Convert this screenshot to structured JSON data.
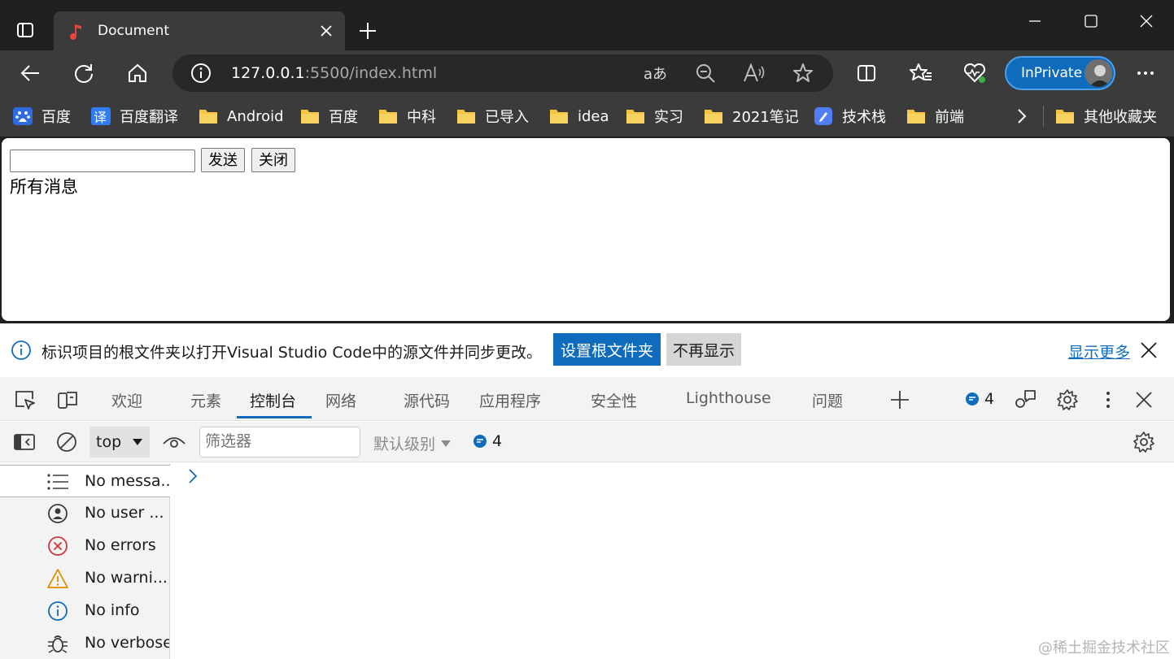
{
  "window": {
    "tab_title": "Document"
  },
  "toolbar": {
    "url_host": "127.0.0.1",
    "url_rest": ":5500/index.html",
    "inprivate_label": "InPrivate"
  },
  "bookmarks": [
    {
      "label": "百度",
      "icon": "baidu-icon"
    },
    {
      "label": "百度翻译",
      "icon": "translate-icon"
    },
    {
      "label": "Android",
      "icon": "folder-icon"
    },
    {
      "label": "百度",
      "icon": "folder-icon"
    },
    {
      "label": "中科",
      "icon": "folder-icon"
    },
    {
      "label": "已导入",
      "icon": "folder-icon"
    },
    {
      "label": "idea",
      "icon": "folder-icon"
    },
    {
      "label": "实习",
      "icon": "folder-icon"
    },
    {
      "label": "2021笔记",
      "icon": "folder-icon"
    },
    {
      "label": "技术栈",
      "icon": "app-icon"
    },
    {
      "label": "前端",
      "icon": "folder-icon"
    }
  ],
  "other_bookmarks_label": "其他收藏夹",
  "page": {
    "send_label": "发送",
    "close_label": "关闭",
    "messages_label": "所有消息"
  },
  "devtools": {
    "infobar": {
      "message": "标识项目的根文件夹以打开Visual Studio Code中的源文件并同步更改。",
      "primary_button": "设置根文件夹",
      "secondary_button": "不再显示",
      "more_link": "显示更多"
    },
    "tabs": [
      "欢迎",
      "元素",
      "控制台",
      "网络",
      "源代码",
      "应用程序",
      "安全性",
      "Lighthouse",
      "问题"
    ],
    "issue_count": "4",
    "context": "top",
    "filter_placeholder": "筛选器",
    "level_label": "默认级别",
    "level_count": "4",
    "sidebar": [
      {
        "label": "No messa...",
        "icon": "list-icon"
      },
      {
        "label": "No user ...",
        "icon": "user-icon"
      },
      {
        "label": "No errors",
        "icon": "error-icon"
      },
      {
        "label": "No warni...",
        "icon": "warning-icon"
      },
      {
        "label": "No info",
        "icon": "info-icon"
      },
      {
        "label": "No verbose",
        "icon": "bug-icon"
      }
    ]
  },
  "watermark": "@稀土掘金技术社区",
  "colors": {
    "accent": "#0f6cbd",
    "chrome_dark": "#202020",
    "chrome_mid": "#3b3b3b"
  }
}
